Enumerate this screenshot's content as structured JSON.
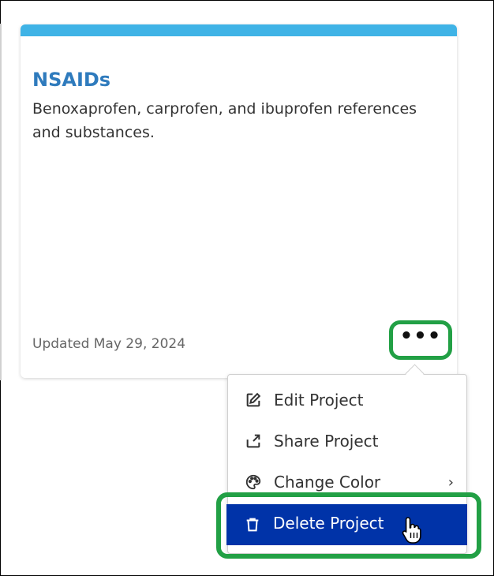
{
  "colors": {
    "card_topbar": "#3fb3e6",
    "title": "#2f7bbd",
    "highlight": "#22a045",
    "delete_bg": "#0033a8"
  },
  "card": {
    "title": "NSAIDs",
    "description": "Benoxaprofen, carprofen, and ibuprofen references and substances.",
    "updated": "Updated May 29, 2024",
    "more_icon": "more-horizontal-icon",
    "more_glyph": "•••"
  },
  "menu": {
    "items": [
      {
        "label": "Edit Project",
        "icon": "edit-icon"
      },
      {
        "label": "Share Project",
        "icon": "share-icon"
      },
      {
        "label": "Change Color",
        "icon": "palette-icon",
        "has_submenu": true
      },
      {
        "label": "Delete Project",
        "icon": "trash-icon",
        "highlighted": true
      }
    ],
    "submenu_glyph": "›"
  },
  "cursor": {
    "icon": "pointer-hand-icon"
  }
}
